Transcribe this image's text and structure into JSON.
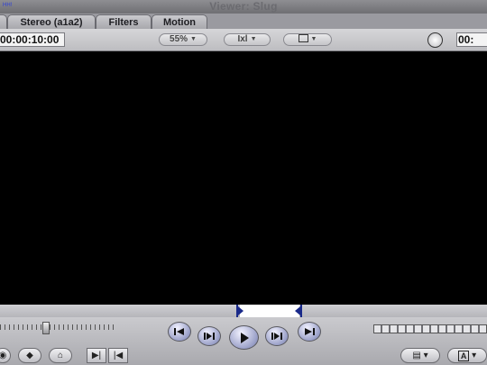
{
  "window": {
    "title": "Viewer: Slug",
    "corner_label": "HH!"
  },
  "tabs": [
    {
      "label": ""
    },
    {
      "label": "Stereo (a1a2)"
    },
    {
      "label": "Filters"
    },
    {
      "label": "Motion"
    }
  ],
  "toolbar": {
    "duration": "00:00:10:00",
    "zoom": "55%",
    "view_mode": "Ixl",
    "overlay_label": "",
    "current_timecode": "00:"
  },
  "colors": {
    "viewer_bg": "#000000",
    "button_tint": "#9aa0c8",
    "in_out_marker": "#1a2a8a"
  },
  "transport": {
    "buttons": [
      "previous-edit",
      "play-in-to-out",
      "play",
      "play-around-current",
      "next-edit"
    ]
  }
}
